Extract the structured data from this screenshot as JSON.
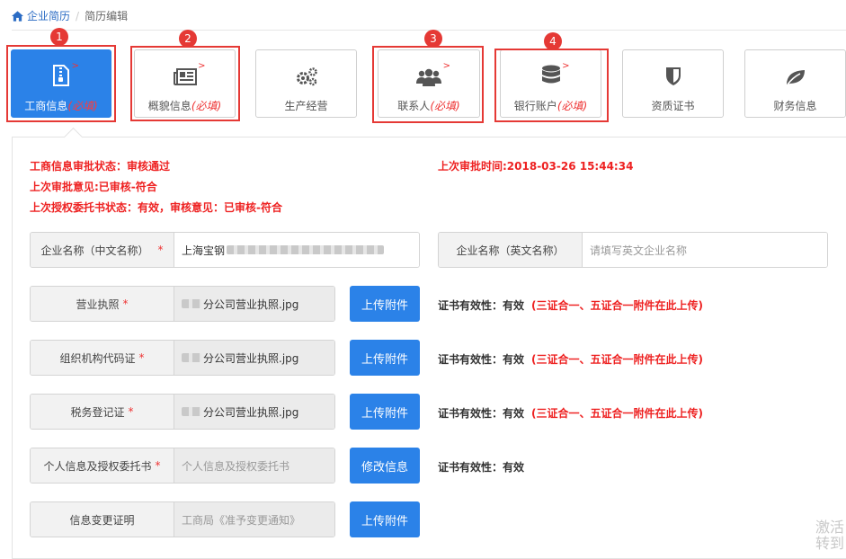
{
  "breadcrumb": {
    "home": "企业简历",
    "current": "简历编辑"
  },
  "tabs": [
    {
      "label": "工商信息",
      "required": "(必填)",
      "icon": "zip-file-icon",
      "active": true
    },
    {
      "label": "概貌信息",
      "required": "(必填)",
      "icon": "newspaper-icon",
      "active": false
    },
    {
      "label": "生产经营",
      "required": "",
      "icon": "gears-icon",
      "active": false
    },
    {
      "label": "联系人",
      "required": "(必填)",
      "icon": "users-icon",
      "active": false
    },
    {
      "label": "银行账户",
      "required": "(必填)",
      "icon": "database-icon",
      "active": false
    },
    {
      "label": "资质证书",
      "required": "",
      "icon": "shield-icon",
      "active": false
    },
    {
      "label": "财务信息",
      "required": "",
      "icon": "leaf-icon",
      "active": false
    }
  ],
  "tab_arrow": ">",
  "badges": [
    "1",
    "2",
    "3",
    "4"
  ],
  "status": {
    "approval_status": "工商信息审批状态：审核通过",
    "last_opinion": "上次审批意见:已审核-符合",
    "auth_status": "上次授权委托书状态：有效，审核意见：已审核-符合",
    "last_time": "上次审批时间:2018-03-26 15:44:34"
  },
  "form": {
    "name_cn_label": "企业名称（中文名称）",
    "name_cn_value": "上海宝钢",
    "name_en_label": "企业名称（英文名称）",
    "name_en_placeholder": "请填写英文企业名称",
    "rows": [
      {
        "label": "营业执照",
        "required": true,
        "value": "分公司营业执照.jpg",
        "button": "上传附件",
        "validity": "证书有效性：有效",
        "note": "(三证合一、五证合一附件在此上传)"
      },
      {
        "label": "组织机构代码证",
        "required": true,
        "value": "分公司营业执照.jpg",
        "button": "上传附件",
        "validity": "证书有效性：有效",
        "note": "(三证合一、五证合一附件在此上传)"
      },
      {
        "label": "税务登记证",
        "required": true,
        "value": "分公司营业执照.jpg",
        "button": "上传附件",
        "validity": "证书有效性：有效",
        "note": "(三证合一、五证合一附件在此上传)"
      },
      {
        "label": "个人信息及授权委托书",
        "required": true,
        "value": "个人信息及授权委托书",
        "button": "修改信息",
        "validity": "证书有效性：有效",
        "note": ""
      },
      {
        "label": "信息变更证明",
        "required": false,
        "value": "工商局《准予变更通知》",
        "button": "上传附件",
        "validity": "",
        "note": ""
      }
    ],
    "star": "*"
  },
  "watermark": {
    "line1": "激活",
    "line2": "转到"
  },
  "colors": {
    "accent": "#2b82e8",
    "highlight": "#e53935",
    "required": "#e22222"
  }
}
